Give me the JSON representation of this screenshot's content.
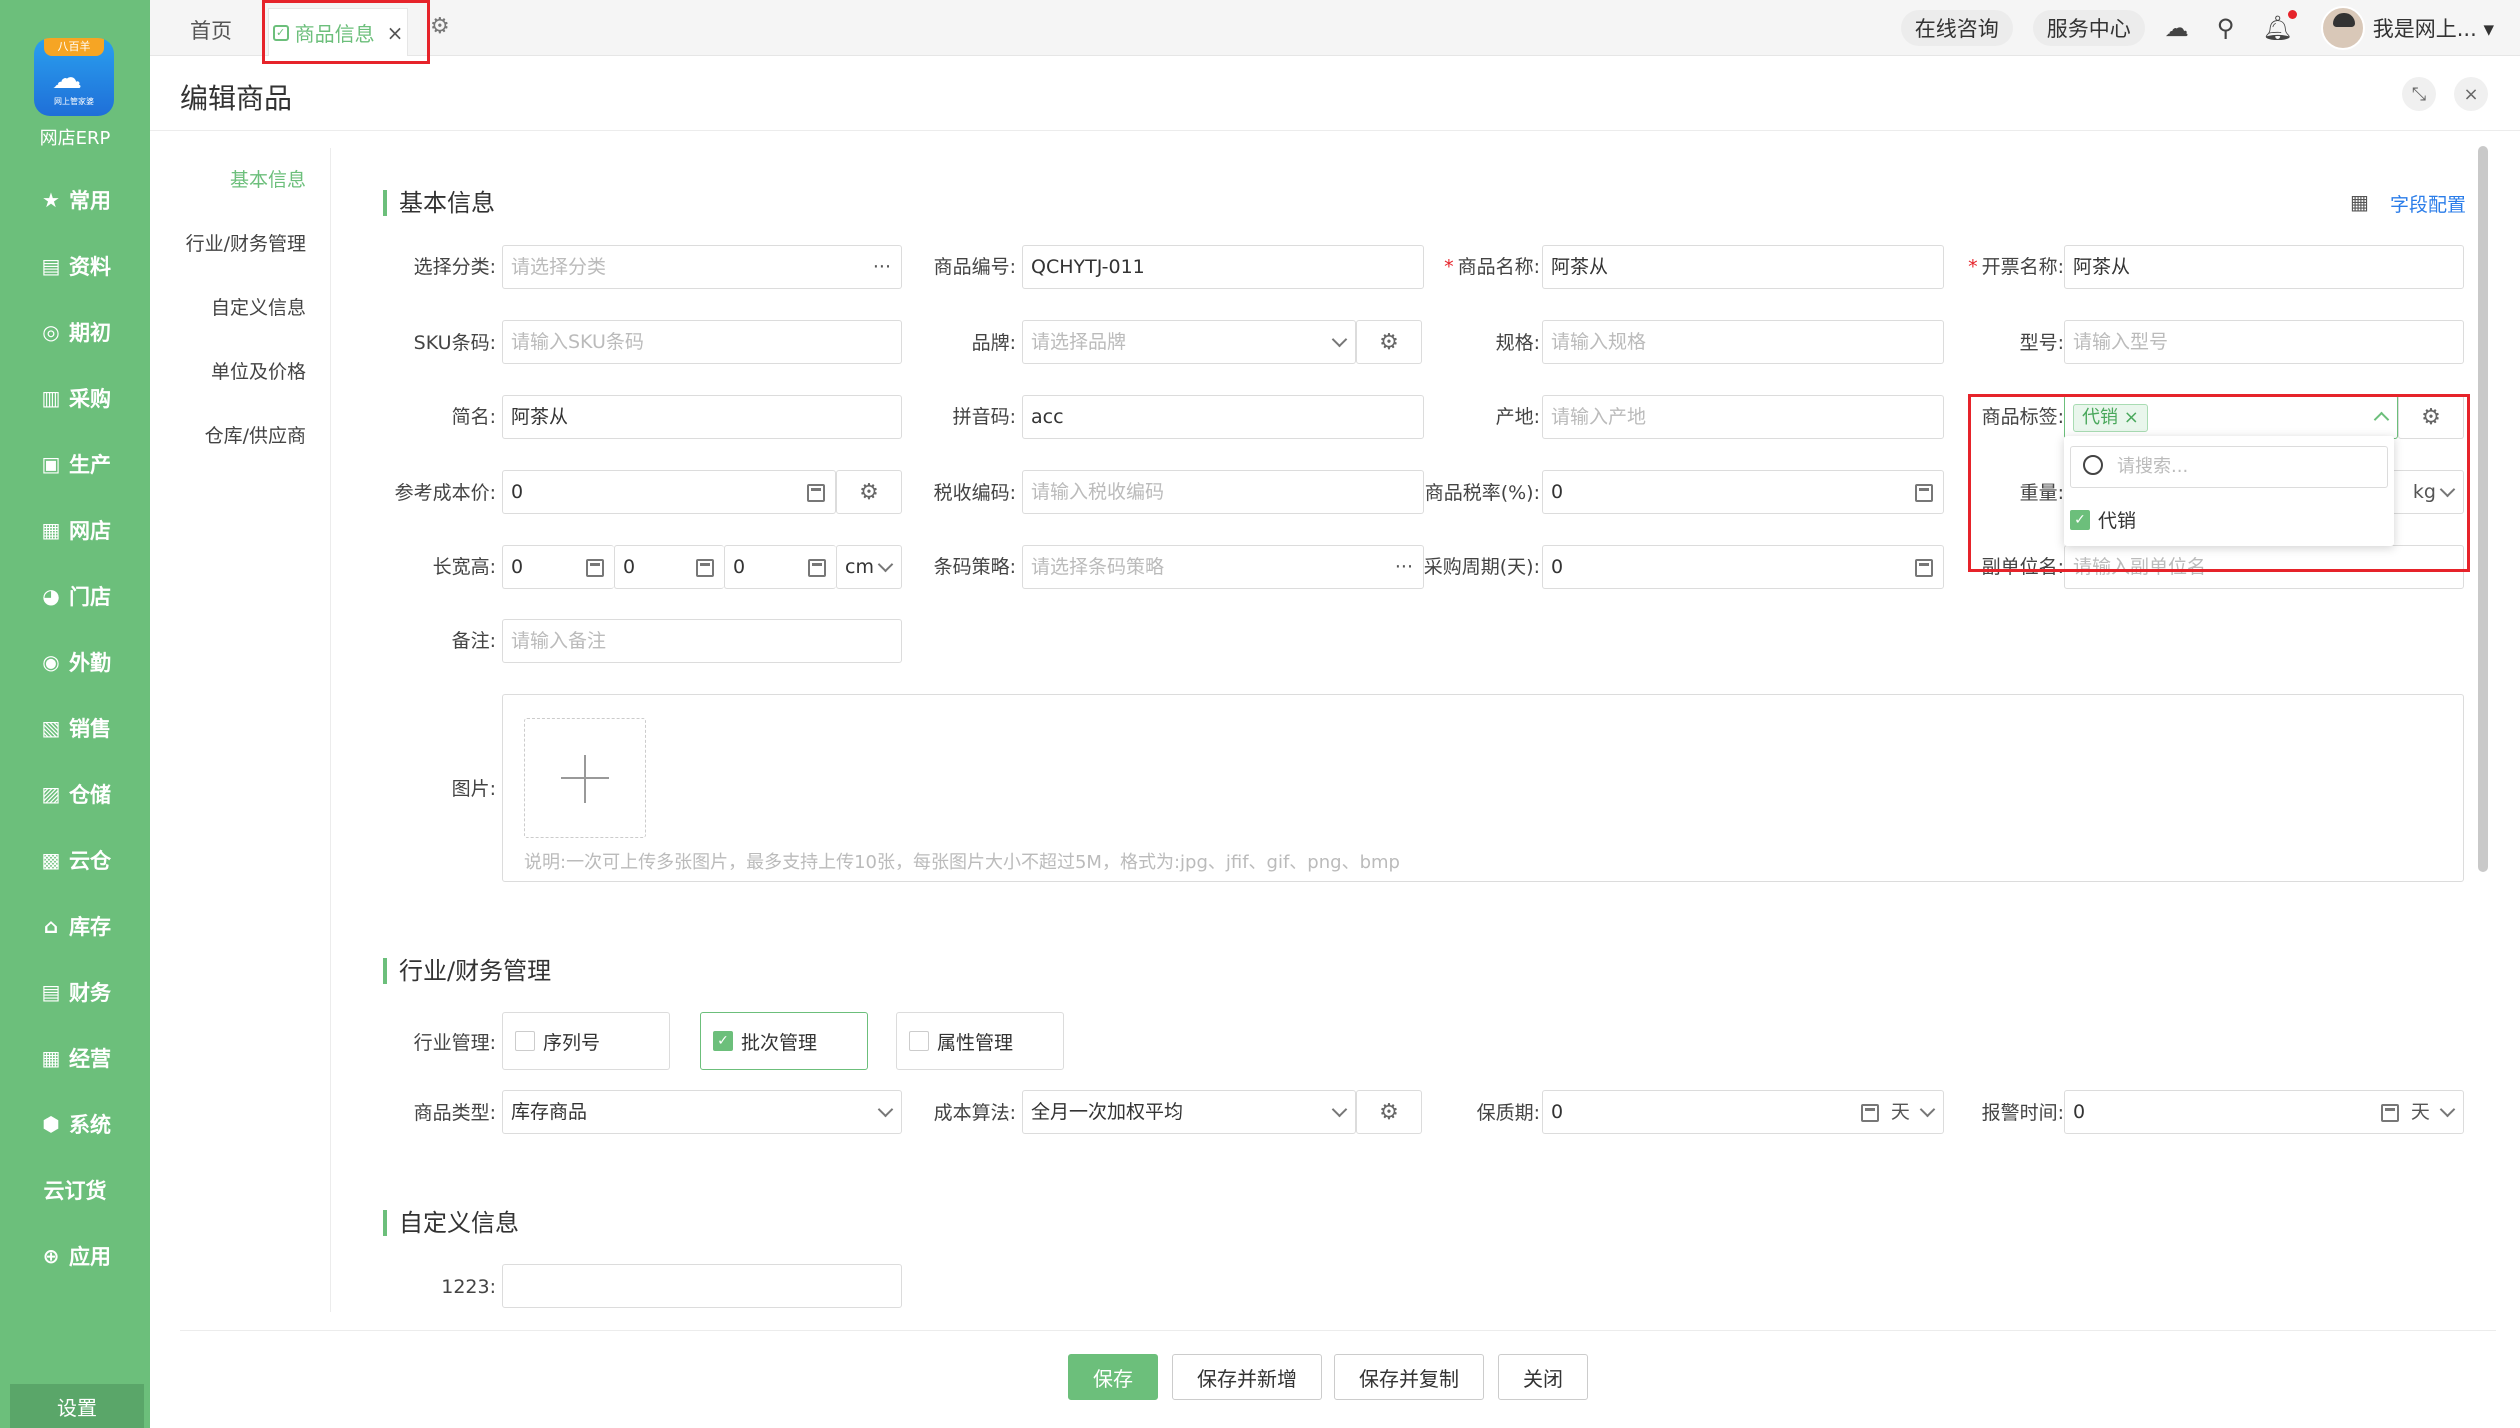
{
  "sidebar": {
    "logo_ribbon": "八百羊",
    "logo_sub": "网上管家婆",
    "logo_text": "网店ERP",
    "items": [
      {
        "label": "常用",
        "icon": "star-icon"
      },
      {
        "label": "资料",
        "icon": "document-icon"
      },
      {
        "label": "期初",
        "icon": "target-icon"
      },
      {
        "label": "采购",
        "icon": "purchase-icon"
      },
      {
        "label": "生产",
        "icon": "production-icon"
      },
      {
        "label": "网店",
        "icon": "shop-icon"
      },
      {
        "label": "门店",
        "icon": "pie-icon"
      },
      {
        "label": "外勤",
        "icon": "fieldwork-icon"
      },
      {
        "label": "销售",
        "icon": "sales-chart-icon"
      },
      {
        "label": "仓储",
        "icon": "warehouse-icon"
      },
      {
        "label": "云仓",
        "icon": "cloud-warehouse-icon"
      },
      {
        "label": "库存",
        "icon": "inventory-icon"
      },
      {
        "label": "财务",
        "icon": "finance-icon"
      },
      {
        "label": "经营",
        "icon": "business-icon"
      },
      {
        "label": "系统",
        "icon": "system-icon"
      },
      {
        "label": "云订货",
        "icon": ""
      },
      {
        "label": "应用",
        "icon": "plus-icon"
      }
    ],
    "settings": "设置"
  },
  "topbar": {
    "home": "首页",
    "active_tab": "商品信息",
    "online_consult": "在线咨询",
    "service_center": "服务中心",
    "user": "我是网上..."
  },
  "header": {
    "title": "编辑商品"
  },
  "leftnav": [
    "基本信息",
    "行业/财务管理",
    "自定义信息",
    "单位及价格",
    "仓库/供应商"
  ],
  "sections": {
    "basic": "基本信息",
    "industry": "行业/财务管理",
    "custom": "自定义信息",
    "field_config": "字段配置"
  },
  "form": {
    "category": {
      "label": "选择分类:",
      "placeholder": "请选择分类"
    },
    "code": {
      "label": "商品编号:",
      "value": "QCHYTJ-011"
    },
    "name": {
      "label": "商品名称:",
      "value": "阿茶从"
    },
    "invoice_name": {
      "label": "开票名称:",
      "value": "阿茶从"
    },
    "sku": {
      "label": "SKU条码:",
      "placeholder": "请输入SKU条码"
    },
    "brand": {
      "label": "品牌:",
      "placeholder": "请选择品牌"
    },
    "spec": {
      "label": "规格:",
      "placeholder": "请输入规格"
    },
    "model": {
      "label": "型号:",
      "placeholder": "请输入型号"
    },
    "short_name": {
      "label": "简名:",
      "value": "阿茶从"
    },
    "pinyin": {
      "label": "拼音码:",
      "value": "acc"
    },
    "origin": {
      "label": "产地:",
      "placeholder": "请输入产地"
    },
    "tags": {
      "label": "商品标签:",
      "tag": "代销"
    },
    "ref_cost": {
      "label": "参考成本价:",
      "value": "0"
    },
    "tax_code": {
      "label": "税收编码:",
      "placeholder": "请输入税收编码"
    },
    "tax_rate": {
      "label": "商品税率(%):",
      "value": "0"
    },
    "weight": {
      "label": "重量:",
      "unit": "kg"
    },
    "dims": {
      "label": "长宽高:",
      "l": "0",
      "w": "0",
      "h": "0",
      "unit": "cm"
    },
    "barcode_policy": {
      "label": "条码策略:",
      "placeholder": "请选择条码策略"
    },
    "purchase_cycle": {
      "label": "采购周期(天):",
      "value": "0"
    },
    "sub_unit": {
      "label": "副单位名:",
      "placeholder": "请输入副单位名"
    },
    "remark": {
      "label": "备注:",
      "placeholder": "请输入备注"
    },
    "image": {
      "label": "图片:",
      "note": "说明:一次可上传多张图片，最多支持上传10张，每张图片大小不超过5M，格式为:jpg、jfif、gif、png、bmp"
    }
  },
  "dropdown": {
    "search_placeholder": "请搜索...",
    "option": "代销"
  },
  "industry": {
    "label": "行业管理:",
    "serial": "序列号",
    "batch": "批次管理",
    "attr": "属性管理",
    "type_label": "商品类型:",
    "type_value": "库存商品",
    "cost_label": "成本算法:",
    "cost_value": "全月一次加权平均",
    "shelf_label": "保质期:",
    "shelf_value": "0",
    "shelf_unit": "天",
    "alert_label": "报警时间:",
    "alert_value": "0",
    "alert_unit": "天"
  },
  "custom": {
    "label": "1223:"
  },
  "buttons": {
    "save": "保存",
    "save_new": "保存并新增",
    "save_copy": "保存并复制",
    "close": "关闭"
  },
  "colors": {
    "accent": "#6cbf7b",
    "highlight": "#e6232a",
    "link": "#2b7de9"
  }
}
